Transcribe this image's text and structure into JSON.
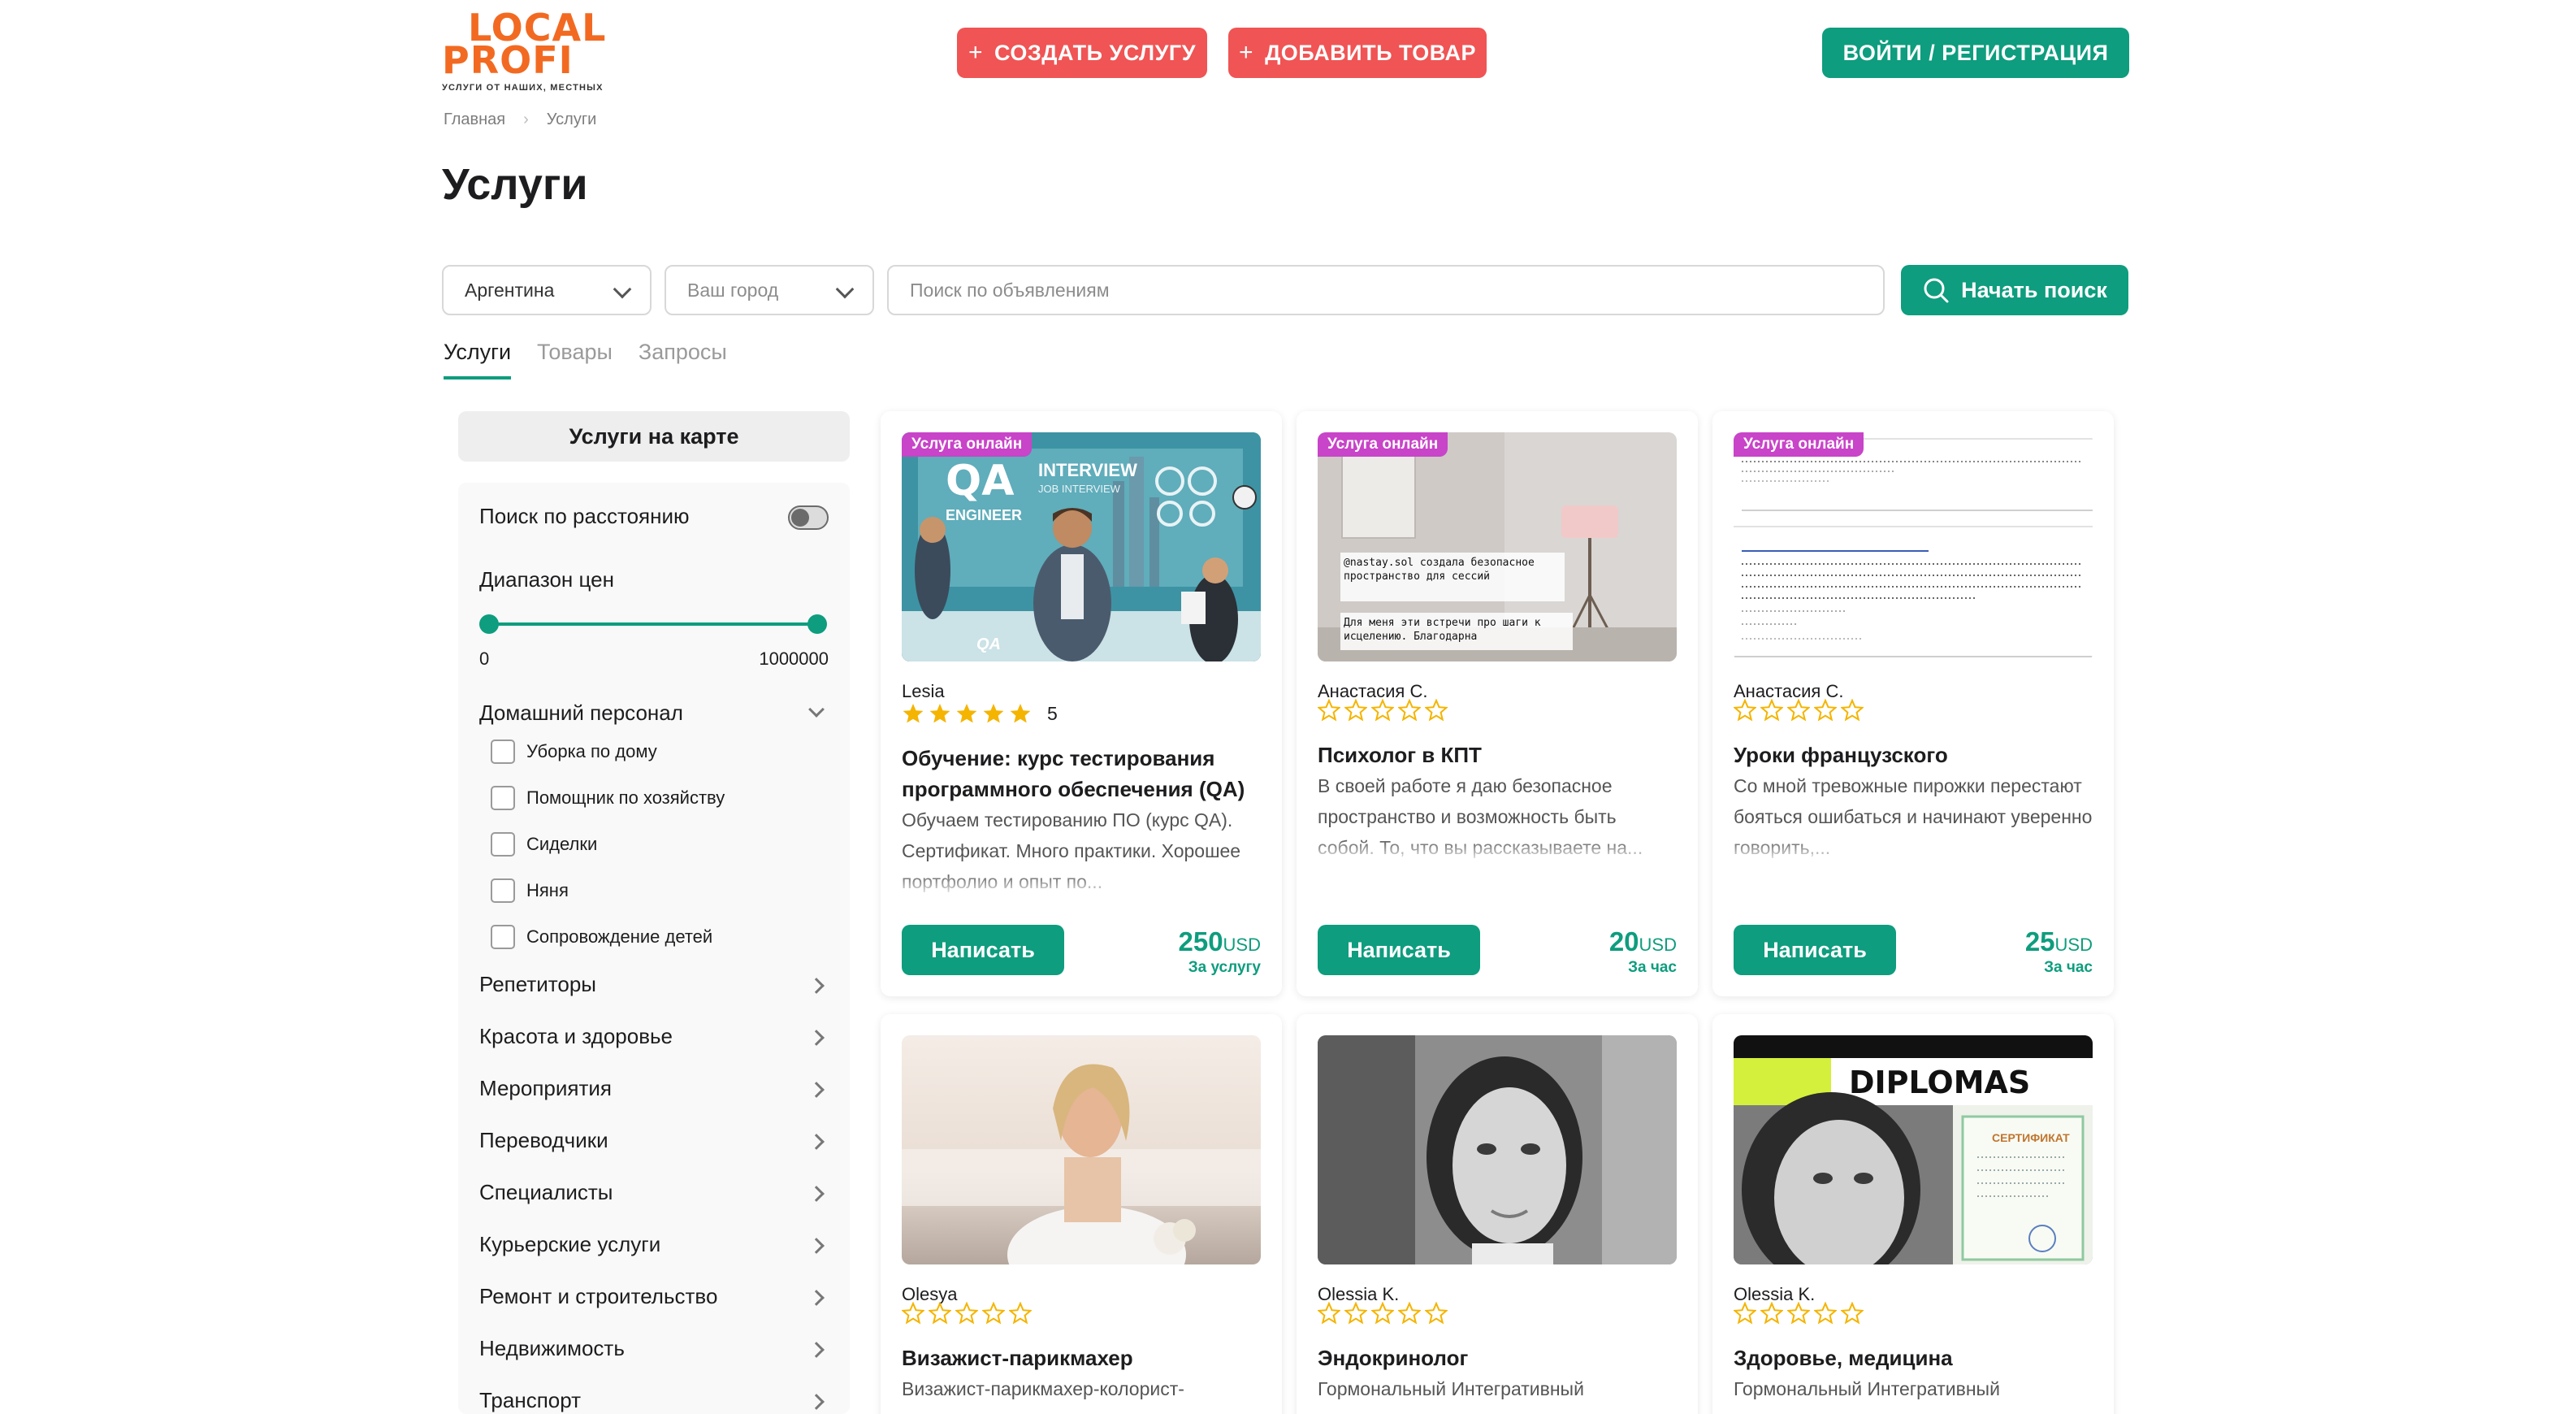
{
  "brand": {
    "logo_line1": "LOCAL",
    "logo_line2": "PROFI",
    "tagline": "УСЛУГИ ОТ НАШИХ, МЕСТНЫХ",
    "accent_color": "#f26a21"
  },
  "header": {
    "create_service": "СОЗДАТЬ УСЛУГУ",
    "add_product": "ДОБАВИТЬ ТОВАР",
    "login": "ВОЙТИ / РЕГИСТРАЦИЯ",
    "plus": "+"
  },
  "breadcrumb": [
    "Главная",
    "Услуги"
  ],
  "page_title": "Услуги",
  "search": {
    "country": "Аргентина",
    "city_placeholder": "Ваш город",
    "query_placeholder": "Поиск по объявлениям",
    "button": "Начать поиск"
  },
  "tabs": [
    {
      "label": "Услуги",
      "active": true
    },
    {
      "label": "Товары",
      "active": false
    },
    {
      "label": "Запросы",
      "active": false
    }
  ],
  "sidebar": {
    "map_button": "Услуги на карте",
    "distance_search": "Поиск по расстоянию",
    "price_range_label": "Диапазон цен",
    "price_min": "0",
    "price_max": "1000000",
    "expanded_category": "Домашний персонал",
    "subcategories": [
      "Уборка по дому",
      "Помощник по хозяйству",
      "Сиделки",
      "Няня",
      "Сопровождение детей"
    ],
    "categories": [
      "Репетиторы",
      "Красота и здоровье",
      "Мероприятия",
      "Переводчики",
      "Специалисты",
      "Курьерские услуги",
      "Ремонт и строительство",
      "Недвижимость",
      "Транспорт"
    ]
  },
  "cards": [
    {
      "badge": "Услуга онлайн",
      "author": "Lesia",
      "rating": 5,
      "rating_label": "5",
      "title": "Обучение: курс тестирования программного обеспечения (QA)",
      "description": "Обучаем тестированию ПО (курс QA). Сертификат. Много практики. Хорошее портфолио и опыт по...",
      "button": "Написать",
      "price": "250",
      "currency": "USD",
      "unit": "За услугу",
      "image_text": {
        "qa": "QA",
        "engineer": "ENGINEER",
        "interview": "INTERVIEW",
        "job": "JOB INTERVIEW"
      }
    },
    {
      "badge": "Услуга онлайн",
      "author": "Анастасия С.",
      "rating": 0,
      "title": "Психолог в КПТ",
      "description": "В своей работе я даю безопасное пространство и возможность быть собой. То, что вы рассказываете на...",
      "button": "Написать",
      "price": "20",
      "currency": "USD",
      "unit": "За час",
      "image_text": {
        "caption_1": "@nastay.sol создала безопасное пространство для сессий",
        "caption_2": "Для меня эти встречи про шаги к исцелению. Благодарна"
      }
    },
    {
      "badge": "Услуга онлайн",
      "author": "Анастасия С.",
      "rating": 0,
      "title": "Уроки французского",
      "description": "Со мной тревожные пирожки перестают бояться ошибаться и начинают уверенно говорить,...",
      "button": "Написать",
      "price": "25",
      "currency": "USD",
      "unit": "За час"
    },
    {
      "author": "Olesya",
      "rating": 0,
      "title": "Визажист-парикмахер",
      "description": "Визажист-парикмахер-колорист-"
    },
    {
      "author": "Olessia K.",
      "rating": 0,
      "title": "Эндокринолог",
      "description": "Гормональный Интегративный"
    },
    {
      "author": "Olessia K.",
      "rating": 0,
      "title": "Здоровье, медицина",
      "description": "Гормональный Интегративный",
      "image_text": {
        "diplomas": "DIPLOMAS",
        "certificate": "СЕРТИФИКАТ"
      }
    }
  ],
  "colors": {
    "primary": "#0e9d7e",
    "danger": "#f05454",
    "badge": "#c844c8",
    "star": "#f5b400"
  }
}
